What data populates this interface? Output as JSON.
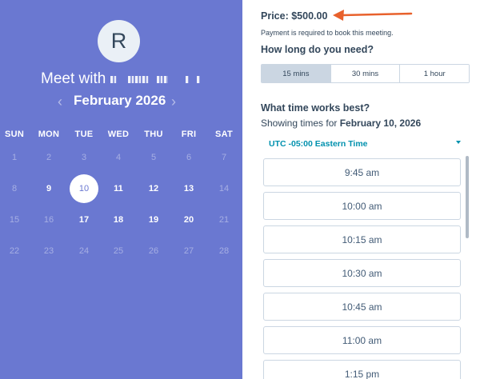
{
  "host": {
    "avatar_initial": "R",
    "meet_with_prefix": "Meet with"
  },
  "calendar": {
    "prev_icon": "chevron-left-icon",
    "next_icon": "chevron-right-icon",
    "month_label": "February 2026",
    "weekdays": [
      "SUN",
      "MON",
      "TUE",
      "WED",
      "THU",
      "FRI",
      "SAT"
    ],
    "weeks": [
      [
        {
          "label": "1",
          "state": "off"
        },
        {
          "label": "2",
          "state": "off"
        },
        {
          "label": "3",
          "state": "off"
        },
        {
          "label": "4",
          "state": "off"
        },
        {
          "label": "5",
          "state": "off"
        },
        {
          "label": "6",
          "state": "off"
        },
        {
          "label": "7",
          "state": "off"
        }
      ],
      [
        {
          "label": "8",
          "state": "off"
        },
        {
          "label": "9",
          "state": "on"
        },
        {
          "label": "10",
          "state": "selected"
        },
        {
          "label": "11",
          "state": "on"
        },
        {
          "label": "12",
          "state": "on"
        },
        {
          "label": "13",
          "state": "on"
        },
        {
          "label": "14",
          "state": "off"
        }
      ],
      [
        {
          "label": "15",
          "state": "off"
        },
        {
          "label": "16",
          "state": "off"
        },
        {
          "label": "17",
          "state": "on"
        },
        {
          "label": "18",
          "state": "on"
        },
        {
          "label": "19",
          "state": "on"
        },
        {
          "label": "20",
          "state": "on"
        },
        {
          "label": "21",
          "state": "off"
        }
      ],
      [
        {
          "label": "22",
          "state": "off"
        },
        {
          "label": "23",
          "state": "off"
        },
        {
          "label": "24",
          "state": "off"
        },
        {
          "label": "25",
          "state": "off"
        },
        {
          "label": "26",
          "state": "off"
        },
        {
          "label": "27",
          "state": "off"
        },
        {
          "label": "28",
          "state": "off"
        }
      ]
    ]
  },
  "booking": {
    "price": "Price: $500.00",
    "payment_note": "Payment is required to book this meeting.",
    "duration_question": "How long do you need?",
    "durations": [
      {
        "label": "15 mins",
        "active": true
      },
      {
        "label": "30 mins",
        "active": false
      },
      {
        "label": "1 hour",
        "active": false
      }
    ],
    "time_question": "What time works best?",
    "showing_prefix": "Showing times for",
    "showing_date": "February 10, 2026",
    "timezone": "UTC -05:00 Eastern Time",
    "timezone_icon": "caret-down-icon",
    "slots": [
      "9:45 am",
      "10:00 am",
      "10:15 am",
      "10:30 am",
      "10:45 am",
      "11:00 am",
      "1:15 pm"
    ]
  },
  "colors": {
    "left_panel": "#6a78d1",
    "accent": "#0091ae",
    "annotation_arrow": "#e8612c",
    "text": "#33475b",
    "border": "#cbd6e2"
  }
}
